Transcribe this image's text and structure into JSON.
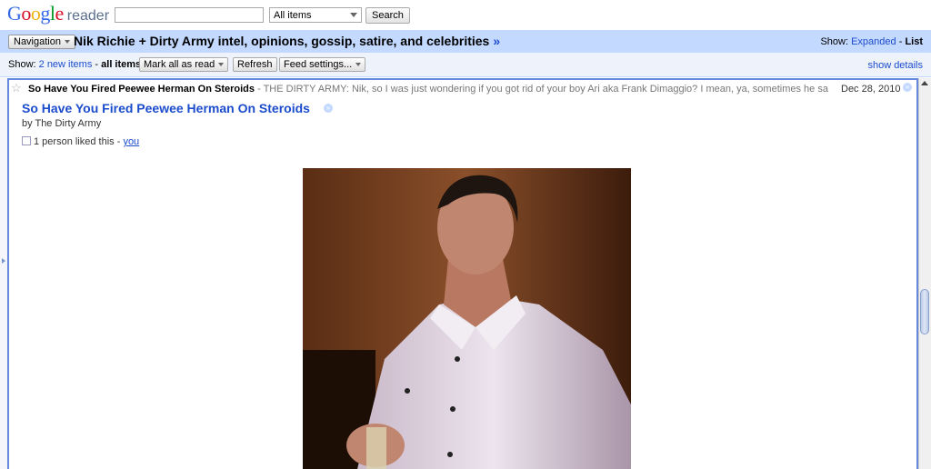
{
  "logo": {
    "google": "Google",
    "reader": "reader"
  },
  "search": {
    "value": "",
    "scope": "All items",
    "button": "Search"
  },
  "title_bar": {
    "navigation_label": "Navigation",
    "feed_title": "Nik Richie + Dirty Army intel, opinions, gossip, satire, and celebrities",
    "feed_chevron": "»",
    "show_label": "Show:",
    "expanded": "Expanded",
    "separator": "-",
    "list": "List"
  },
  "toolbar": {
    "show_label": "Show:",
    "new_items": "2 new items",
    "separator": "-",
    "all_items": "all items",
    "mark_all_read": "Mark all as read",
    "refresh": "Refresh",
    "feed_settings": "Feed settings...",
    "show_details": "show details"
  },
  "entry": {
    "header_title": "So Have You Fired Peewee Herman On Steroids",
    "header_snippet": " - THE DIRTY ARMY: Nik, so I was just wondering if you got rid of your boy Ari aka Frank Dimaggio? I mean, ya, sometimes he says funny",
    "date": "Dec 28, 2010",
    "title": "So Have You Fired Peewee Herman On Steroids",
    "byline": "by The Dirty Army",
    "liked_text": "1 person liked this - ",
    "liked_link": "you"
  },
  "colors": {
    "accent_blue": "#c3d9ff",
    "link": "#1b4ccc",
    "border": "#6688dd"
  }
}
